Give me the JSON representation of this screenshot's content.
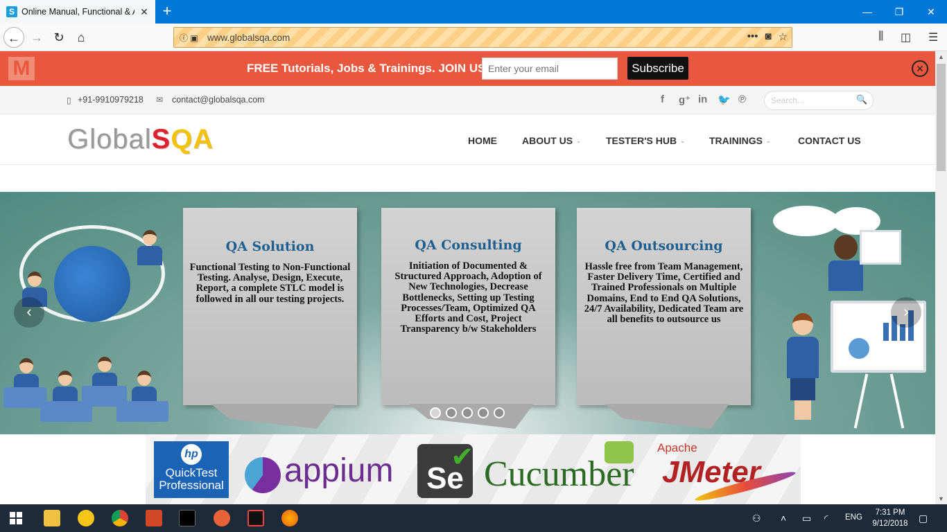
{
  "browser": {
    "tab_title": "Online Manual, Functional & A",
    "url": "www.globalsqa.com"
  },
  "promo": {
    "logo_letter": "M",
    "text": "FREE Tutorials, Jobs & Trainings. JOIN US",
    "email_placeholder": "Enter your email",
    "subscribe_label": "Subscribe"
  },
  "contact": {
    "phone": "+91-9910979218",
    "email": "contact@globalsqa.com",
    "search_placeholder": "Search..."
  },
  "header": {
    "logo_global": "Global",
    "logo_s": "S",
    "logo_qa": "QA",
    "menu": [
      "HOME",
      "ABOUT US",
      "TESTER'S HUB",
      "TRAININGS",
      "CONTACT US"
    ]
  },
  "slider": {
    "cards": [
      {
        "title": "QA Solution",
        "body": "Functional Testing to Non-Functional Testing. Analyse, Design, Execute, Report, a complete STLC model is followed in all our testing projects."
      },
      {
        "title": "QA Consulting",
        "body": "Initiation of Documented & Structured Approach, Adoption of New Technologies, Decrease Bottlenecks, Setting up Testing Processes/Team, Optimized QA Efforts and Cost, Project Transparency b/w Stakeholders"
      },
      {
        "title": "QA Outsourcing",
        "body": "Hassle free from Team Management, Faster Delivery Time, Certified and Trained Professionals on Multiple Domains, End to End QA Solutions, 24/7 Availability, Dedicated Team are all benefits to outsource us"
      }
    ],
    "dot_count": 5,
    "active_dot": 0
  },
  "logos": {
    "hp_line1": "QuickTest",
    "hp_line2": "Professional",
    "hp_mark": "hp",
    "appium": "appium",
    "selenium": "Se",
    "cucumber": "Cucumber",
    "apache": "Apache",
    "jmeter": "JMeter"
  },
  "taskbar": {
    "lang": "ENG",
    "time": "7:31 PM",
    "date": "9/12/2018"
  },
  "colors": {
    "titlebar": "#0078d7",
    "promo": "#e9573f",
    "slider_teal": "#4f8a80",
    "card_title": "#1f5f8f"
  }
}
